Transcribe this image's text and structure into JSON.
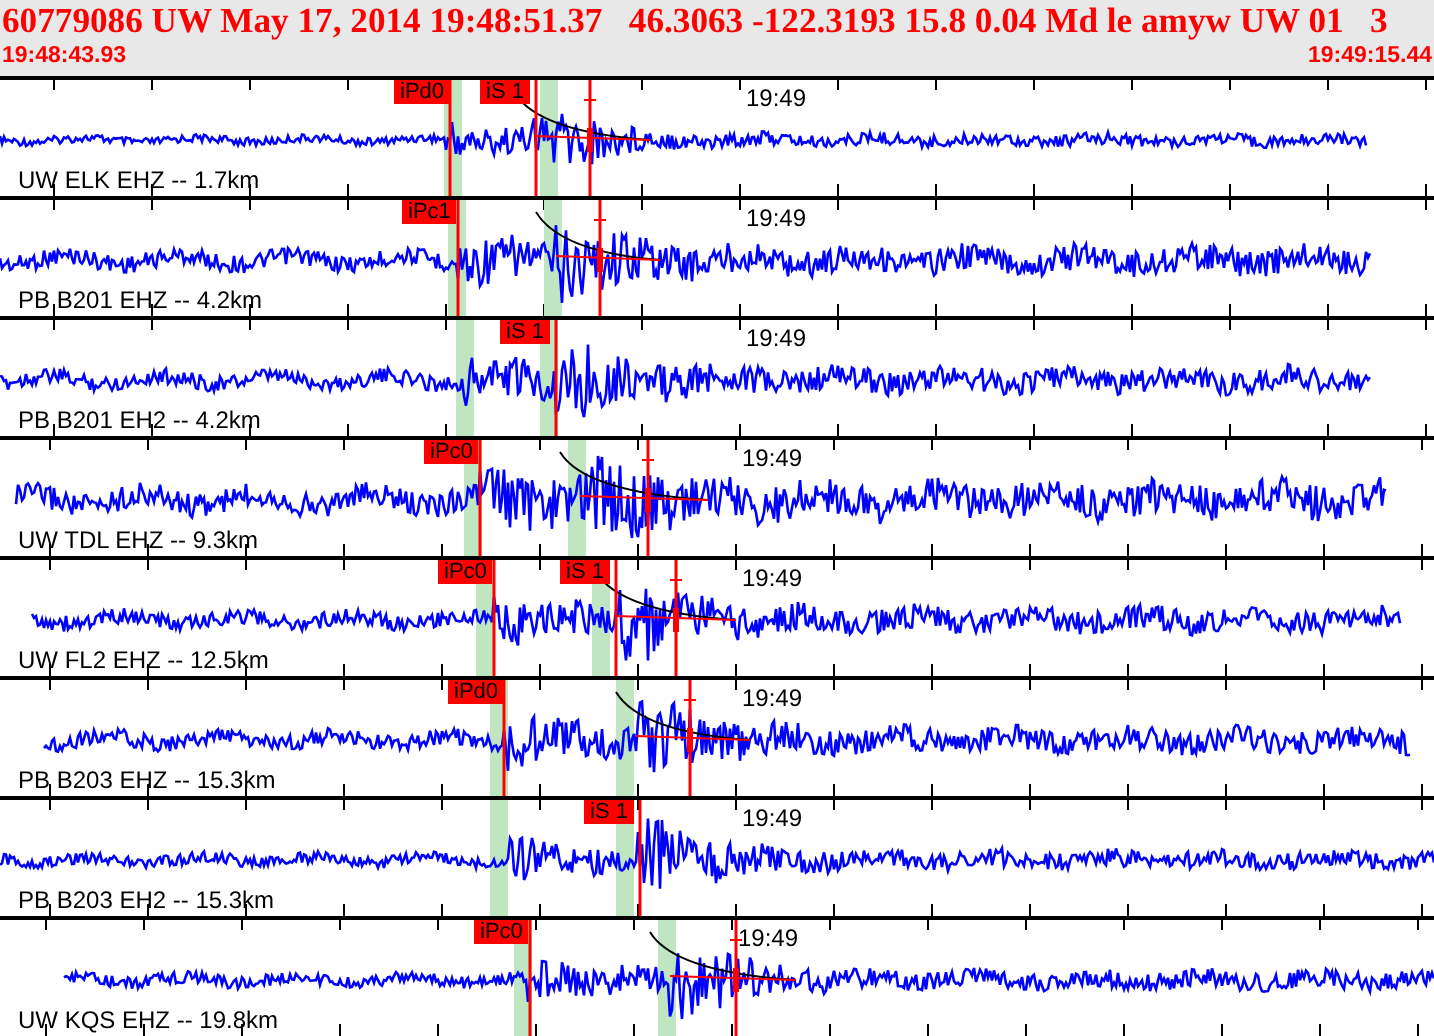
{
  "header": {
    "title": "60779086 UW May 17, 2014 19:48:51.37   46.3063 -122.3193 15.8 0.04 Md le amyw UW 01   3",
    "start_time": "19:48:43.93",
    "end_time": "19:49:15.44"
  },
  "traces": [
    {
      "station": "UW ELK EHZ -- 1.7km",
      "time_label": "19:49",
      "picks": [
        {
          "label": "iPd0"
        },
        {
          "label": "iS 1"
        }
      ]
    },
    {
      "station": "PB B201 EHZ -- 4.2km",
      "time_label": "19:49",
      "picks": [
        {
          "label": "iPc1"
        }
      ]
    },
    {
      "station": "PB B201 EH2 -- 4.2km",
      "time_label": "19:49",
      "picks": [
        {
          "label": "iS 1"
        }
      ]
    },
    {
      "station": "UW TDL EHZ -- 9.3km",
      "time_label": "19:49",
      "picks": [
        {
          "label": "iPc0"
        }
      ]
    },
    {
      "station": "UW FL2 EHZ -- 12.5km",
      "time_label": "19:49",
      "picks": [
        {
          "label": "iPc0"
        },
        {
          "label": "iS 1"
        }
      ]
    },
    {
      "station": "PB B203 EHZ -- 15.3km",
      "time_label": "19:49",
      "picks": [
        {
          "label": "iPd0"
        }
      ]
    },
    {
      "station": "PB B203 EH2 -- 15.3km",
      "time_label": "19:49",
      "picks": [
        {
          "label": "iS 1"
        }
      ]
    },
    {
      "station": "UW KQS EHZ -- 19.8km",
      "time_label": "19:49",
      "picks": [
        {
          "label": "iPc0"
        }
      ]
    }
  ]
}
